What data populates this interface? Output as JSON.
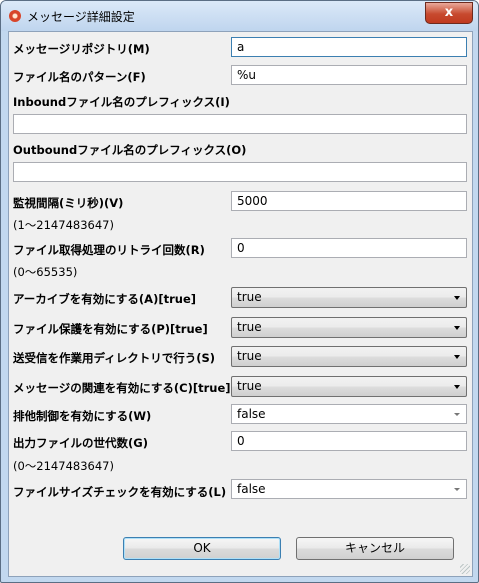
{
  "window": {
    "title": "メッセージ詳細設定",
    "close_label": "x"
  },
  "fields": {
    "repository": {
      "label": "メッセージリポジトリ(M)",
      "value": "a"
    },
    "file_pattern": {
      "label": "ファイル名のパターン(F)",
      "value": "%u"
    },
    "inbound_prefix": {
      "label": "Inboundファイル名のプレフィックス(I)",
      "value": ""
    },
    "outbound_prefix": {
      "label": "Outboundファイル名のプレフィックス(O)",
      "value": ""
    },
    "poll_interval": {
      "label": "監視間隔(ミリ秒)(V)",
      "value": "5000",
      "range": "(1～2147483647)"
    },
    "retry_count": {
      "label": "ファイル取得処理のリトライ回数(R)",
      "value": "0",
      "range": "(0～65535)"
    },
    "archive": {
      "label": "アーカイブを有効にする(A)[true]",
      "value": "true"
    },
    "file_protect": {
      "label": "ファイル保護を有効にする(P)[true]",
      "value": "true"
    },
    "work_dir": {
      "label": "送受信を作業用ディレクトリで行う(S)",
      "value": "true"
    },
    "msg_relation": {
      "label": "メッセージの関連を有効にする(C)[true]",
      "value": "true"
    },
    "exclusive": {
      "label": "排他制御を有効にする(W)",
      "value": "false"
    },
    "generations": {
      "label": "出力ファイルの世代数(G)",
      "value": "0",
      "range": "(0～2147483647)"
    },
    "size_check": {
      "label": "ファイルサイズチェックを有効にする(L)",
      "value": "false"
    }
  },
  "buttons": {
    "ok": "OK",
    "cancel": "キャンセル"
  }
}
